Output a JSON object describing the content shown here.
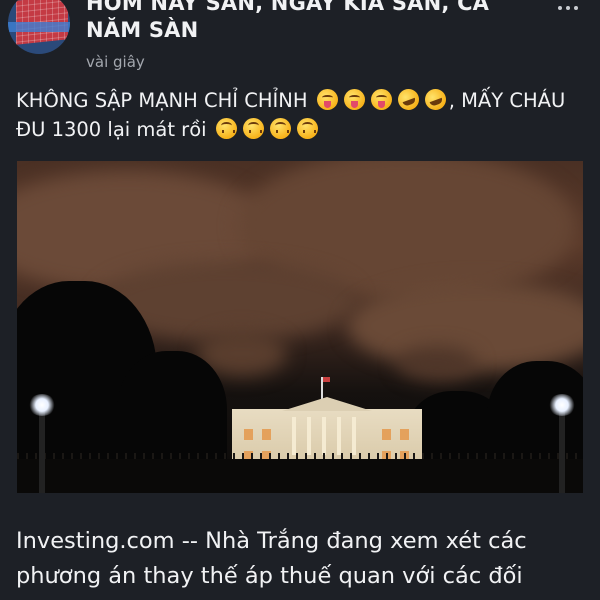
{
  "post": {
    "author": "HÔM NAY SÀN, NGÀY KIA SÀN, CẢ NĂM SÀN",
    "timestamp": "vài giây",
    "text_part1": "KHÔNG SẬP MẠNH CHỈ CHỈNH",
    "text_part2": ", MẤY CHÁU ĐU 1300 lại mát rồi",
    "emojis_line1": [
      "zany-face",
      "zany-face",
      "zany-face",
      "rofl-face",
      "rofl-face"
    ],
    "emojis_line2": [
      "upside-down-face",
      "upside-down-face",
      "upside-down-face",
      "upside-down-face"
    ],
    "image_subject": "",
    "article_excerpt": "Investing.com -- Nhà Trắng đang xem xét các phương án thay thế áp thuế quan với các đối"
  },
  "icons": {
    "more_options": "more-options-icon",
    "avatar": "avatar"
  },
  "colors": {
    "background": "#1d2026",
    "text": "#f1f2f4",
    "muted": "#a3a7ae"
  }
}
